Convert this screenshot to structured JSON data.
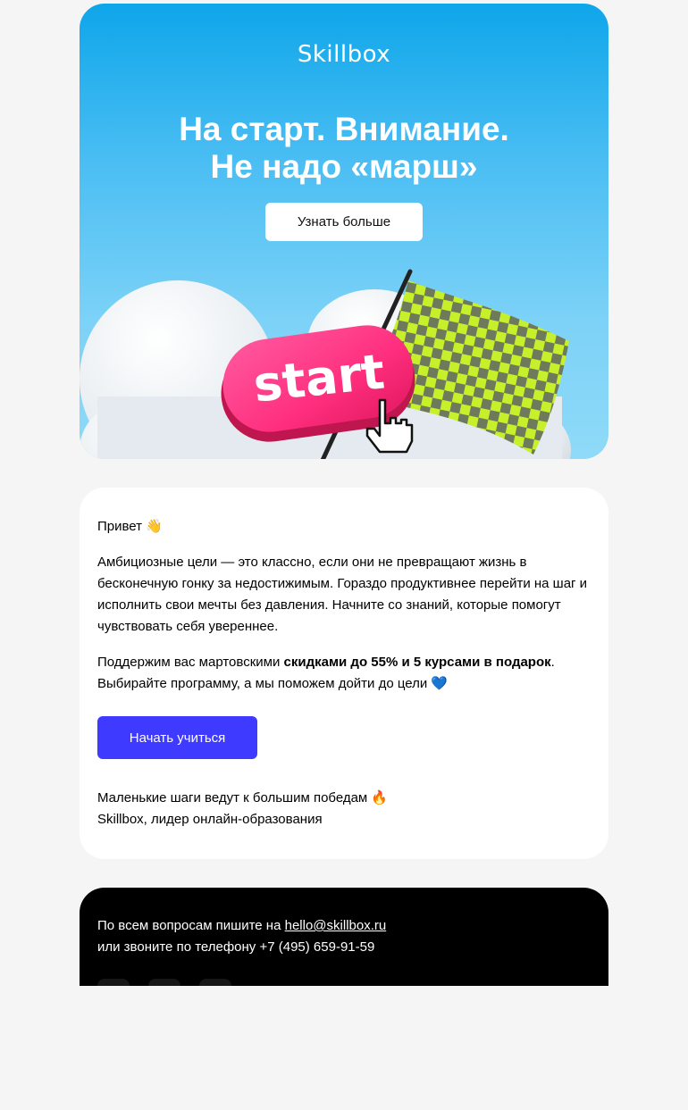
{
  "hero": {
    "logo": "Skillbox",
    "headline_line1": "На старт. Внимание.",
    "headline_line2": "Не надо «марш»",
    "button_label": "Узнать больше",
    "start_word": "start"
  },
  "body": {
    "greeting": "Привет 👋",
    "paragraph1": "Амбициозные цели — это классно, если они не превращают жизнь в бесконечную гонку за недостижимым. Гораздо продуктивнее перейти на шаг и исполнить свои мечты без давления. Начните со знаний, которые помогут чувствовать себя увереннее.",
    "offer_prefix": "Поддержим вас мартовскими ",
    "offer_bold": "скидками до 55% и 5 курсами в подарок",
    "offer_suffix": ". Выбирайте программу, а мы поможем дойти до цели 💙",
    "cta_label": "Начать учиться",
    "sign_line1": "Маленькие шаги ведут к большим победам 🔥",
    "sign_line2": "Skillbox, лидер онлайн-образования"
  },
  "footer": {
    "line1_prefix": "По всем вопросам пишите на ",
    "email": "hello@skillbox.ru",
    "line2": "или звоните по телефону +7 (495) 659-91-59"
  },
  "colors": {
    "accent": "#3f3aff",
    "hero_top": "#0ea6ea",
    "hero_bottom": "#8fdaf8",
    "pink": "#ff3d8b",
    "flag_green": "#c5f02a"
  }
}
